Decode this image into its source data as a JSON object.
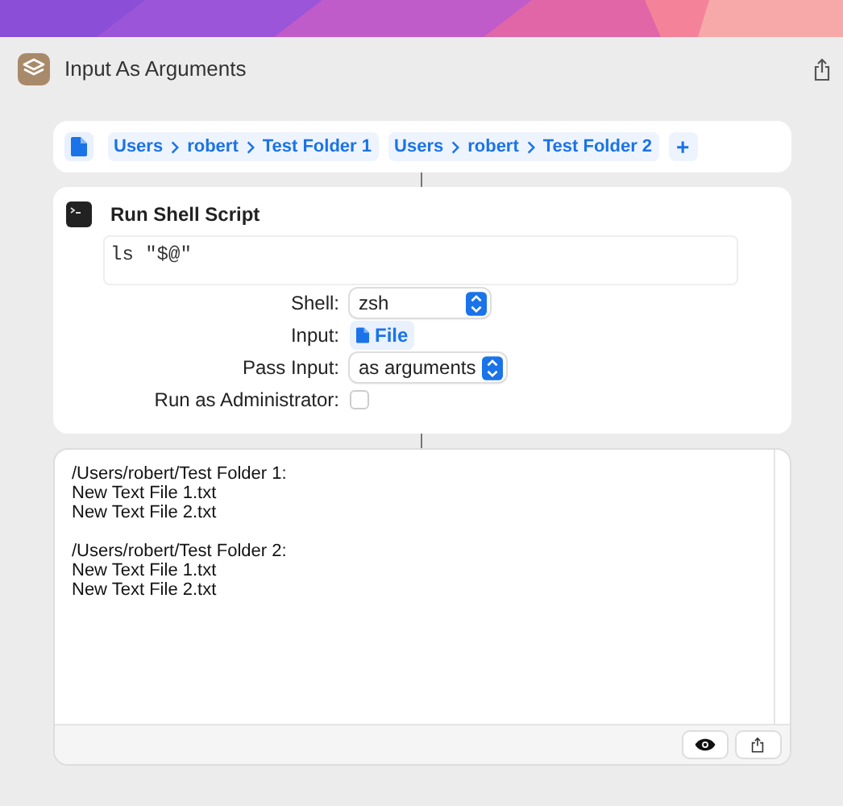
{
  "window": {
    "title": "Input As Arguments"
  },
  "input_bar": {
    "paths": [
      {
        "parts": [
          "Users",
          "robert",
          "Test Folder 1"
        ]
      },
      {
        "parts": [
          "Users",
          "robert",
          "Test Folder 2"
        ]
      }
    ],
    "add": "+"
  },
  "action": {
    "title": "Run Shell Script",
    "script": "ls \"$@\"",
    "fields": [
      {
        "kind": "select",
        "label": "Shell:",
        "value": "zsh"
      },
      {
        "kind": "token",
        "label": "Input:",
        "value": "File"
      },
      {
        "kind": "select",
        "label": "Pass Input:",
        "value": "as arguments"
      },
      {
        "kind": "checkbox",
        "label": "Run as Administrator:",
        "checked": false
      }
    ]
  },
  "output": {
    "blocks": [
      {
        "lines": [
          "/Users/robert/Test Folder 1:",
          "New Text File 1.txt",
          "New Text File 2.txt"
        ]
      },
      {
        "lines": [
          "/Users/robert/Test Folder 2:",
          "New Text File 1.txt",
          "New Text File 2.txt"
        ]
      }
    ]
  }
}
